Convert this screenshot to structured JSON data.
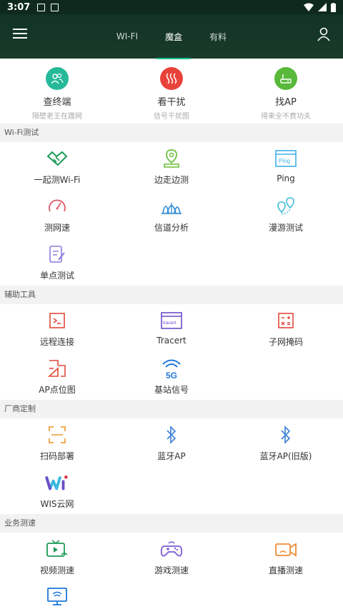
{
  "status": {
    "time": "3:07"
  },
  "tabs": [
    "WI-FI",
    "魔盒",
    "有料"
  ],
  "top": [
    {
      "title": "查终端",
      "sub": "隔壁老王在蹭网"
    },
    {
      "title": "看干扰",
      "sub": "信号干扰图"
    },
    {
      "title": "找AP",
      "sub": "得来全不费功夫"
    }
  ],
  "sections": {
    "wifi": {
      "title": "Wi-Fi测试",
      "items": [
        "一起测Wi-Fi",
        "边走边测",
        "Ping",
        "测网速",
        "信道分析",
        "漫游测试",
        "单点测试"
      ]
    },
    "tools": {
      "title": "辅助工具",
      "items": [
        "远程连接",
        "Tracert",
        "子网掩码",
        "AP点位图",
        "基站信号"
      ]
    },
    "vendor": {
      "title": "厂商定制",
      "items": [
        "扫码部署",
        "蓝牙AP",
        "蓝牙AP(旧版)",
        "WIS云网"
      ]
    },
    "biz": {
      "title": "业务测速",
      "items": [
        "视频测速",
        "游戏测速",
        "直播测速"
      ]
    }
  },
  "icon_text": {
    "ping": "Ping",
    "tracert": "tracert",
    "g5": "5G"
  },
  "colors": {
    "accent": "#18c08a",
    "header": "#123424"
  }
}
